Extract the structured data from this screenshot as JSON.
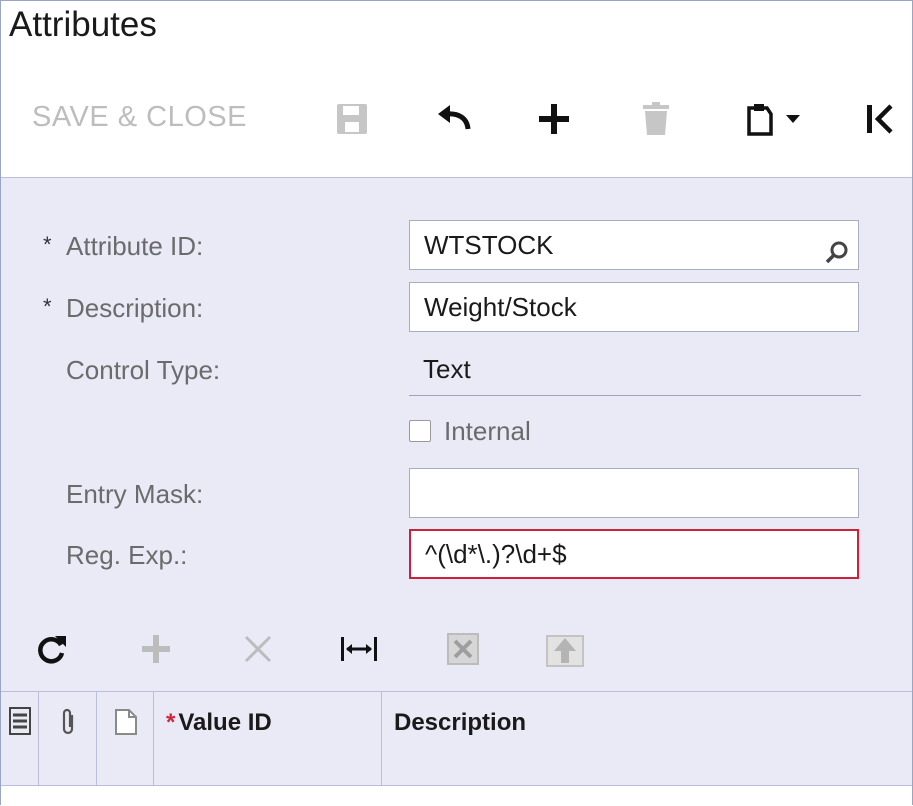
{
  "window": {
    "title": "Attributes"
  },
  "toolbar": {
    "save_close_label": "SAVE & CLOSE",
    "icons": [
      "save-icon",
      "undo-icon",
      "add-icon",
      "delete-icon",
      "clipboard-icon",
      "first-record-icon"
    ]
  },
  "form": {
    "attribute_id": {
      "label": "Attribute ID:",
      "value": "WTSTOCK",
      "required": "*"
    },
    "description": {
      "label": "Description:",
      "value": "Weight/Stock",
      "required": "*"
    },
    "control_type": {
      "label": "Control Type:",
      "value": "Text"
    },
    "internal": {
      "label": "Internal",
      "checked": false
    },
    "entry_mask": {
      "label": "Entry Mask:",
      "value": ""
    },
    "reg_exp": {
      "label": "Reg. Exp.:",
      "value": "^(\\d*\\.)?\\d+$"
    }
  },
  "grid": {
    "toolbar_icons": [
      "refresh-icon",
      "add-row-icon",
      "delete-row-icon",
      "fit-columns-icon",
      "export-excel-icon",
      "upload-icon"
    ],
    "columns": {
      "value_id": {
        "label": "Value ID",
        "required": "*"
      },
      "description": {
        "label": "Description"
      }
    }
  },
  "colors": {
    "panel_bg": "#e9eaf6",
    "error_border": "#c8233b",
    "required_star": "#d0253a"
  }
}
